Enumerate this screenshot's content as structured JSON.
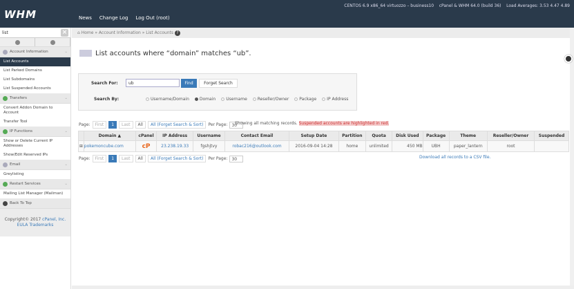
{
  "header": {
    "logo": "WHM",
    "nav": [
      "News",
      "Change Log",
      "Log Out (root)"
    ],
    "sysinfo": "CENTOS 6.9 x86_64 virtuozzo – business10    cPanel & WHM 64.0 (build 36)    Load Averages: 3.53 4.47 4.89"
  },
  "sidebar": {
    "search": "list",
    "groups": [
      {
        "label": "Account Information",
        "items": [
          "List Accounts",
          "List Parked Domains",
          "List Subdomains",
          "List Suspended Accounts"
        ]
      },
      {
        "label": "Transfers",
        "items": [
          "Convert Addon Domain to Account",
          "Transfer Tool"
        ]
      },
      {
        "label": "IP Functions",
        "items": [
          "Show or Delete Current IP Addresses",
          "Show/Edit Reserved IPs"
        ]
      },
      {
        "label": "Email",
        "items": [
          "Greylisting"
        ]
      },
      {
        "label": "Restart Services",
        "items": [
          "Mailing List Manager (Mailman)"
        ]
      }
    ],
    "back_to_top": "Back To Top",
    "copyright": "Copyright© 2017",
    "cpanel_link": "cPanel, Inc.",
    "eula": "EULA",
    "trademarks": "Trademarks"
  },
  "breadcrumb": "Home » Account Information » List Accounts",
  "title": "List accounts where “domain” matches “ub”.",
  "search": {
    "for_label": "Search For:",
    "value": "ub",
    "find": "Find",
    "forget": "Forget Search",
    "by_label": "Search By:",
    "options": [
      "Username/Domain",
      "Domain",
      "Username",
      "Reseller/Owner",
      "Package",
      "IP Address"
    ],
    "selected": 1
  },
  "pager": {
    "page": "Page:",
    "first": "First",
    "current": "1",
    "last": "Last",
    "all": "All",
    "all_forget": "All (Forget Search & Sort)",
    "per_page": "Per Page:",
    "per_value": "30"
  },
  "showing": "Showing all matching records.",
  "suspended_note": "Suspended accounts are highlighted in red.",
  "table": {
    "headers": [
      "",
      "Domain ▲",
      "cPanel",
      "IP Address",
      "Username",
      "Contact Email",
      "Setup Date",
      "Partition",
      "Quota",
      "Disk Used",
      "Package",
      "Theme",
      "Reseller/Owner",
      "Suspended"
    ],
    "rows": [
      [
        "⊞",
        "pokemoncube.com",
        "cP",
        "23.238.19.33",
        "fgshjtvy",
        "robac216@outlook.com",
        "2016-09-04 14:28",
        "home",
        "unlimited",
        "450 MB",
        "UBH",
        "paper_lantern",
        "root",
        ""
      ]
    ]
  },
  "csv": "Download all records to a CSV file."
}
